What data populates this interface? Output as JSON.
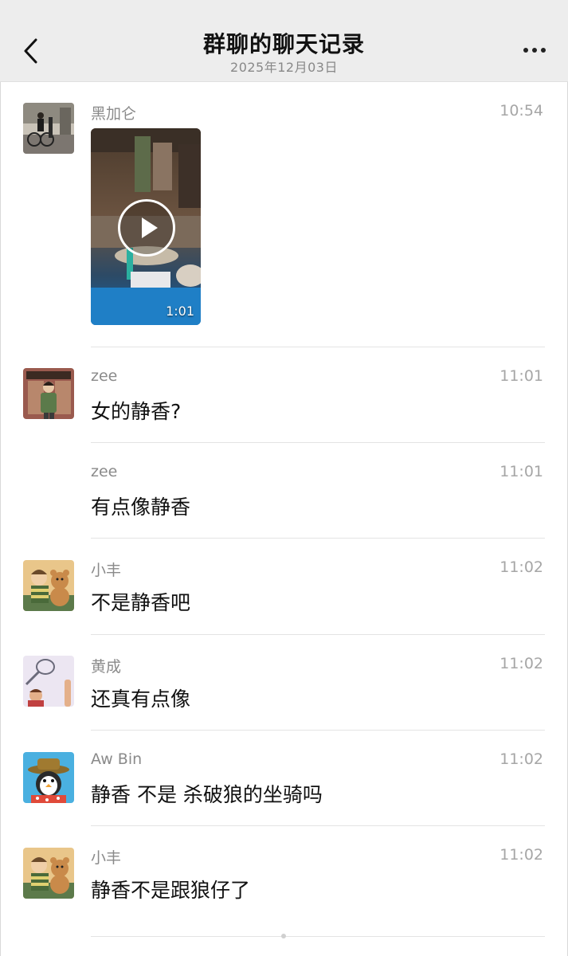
{
  "header": {
    "title": "群聊的聊天记录",
    "date": "2025年12月03日",
    "background": "#ededed"
  },
  "messages": [
    {
      "sender": "黑加仑",
      "time": "10:54",
      "type": "video",
      "duration": "1:01",
      "avatar": "cyclist-street-photo"
    },
    {
      "sender": "zee",
      "time": "11:01",
      "type": "text",
      "text": "女的静香?",
      "avatar": "anime-man-window"
    },
    {
      "sender": "zee",
      "time": "11:01",
      "type": "text",
      "text": "有点像静香"
    },
    {
      "sender": "小丰",
      "time": "11:02",
      "type": "text",
      "text": "不是静香吧",
      "avatar": "boy-with-teddy-bear"
    },
    {
      "sender": "黄成",
      "time": "11:02",
      "type": "text",
      "text": "还真有点像",
      "avatar": "hand-holding-racket"
    },
    {
      "sender": "Aw Bin",
      "time": "11:02",
      "type": "text",
      "text": "静香 不是 杀破狼的坐骑吗",
      "avatar": "penguin-with-hat"
    },
    {
      "sender": "小丰",
      "time": "11:02",
      "type": "text",
      "text": "静香不是跟狼仔了",
      "avatar": "boy-with-teddy-bear"
    }
  ]
}
